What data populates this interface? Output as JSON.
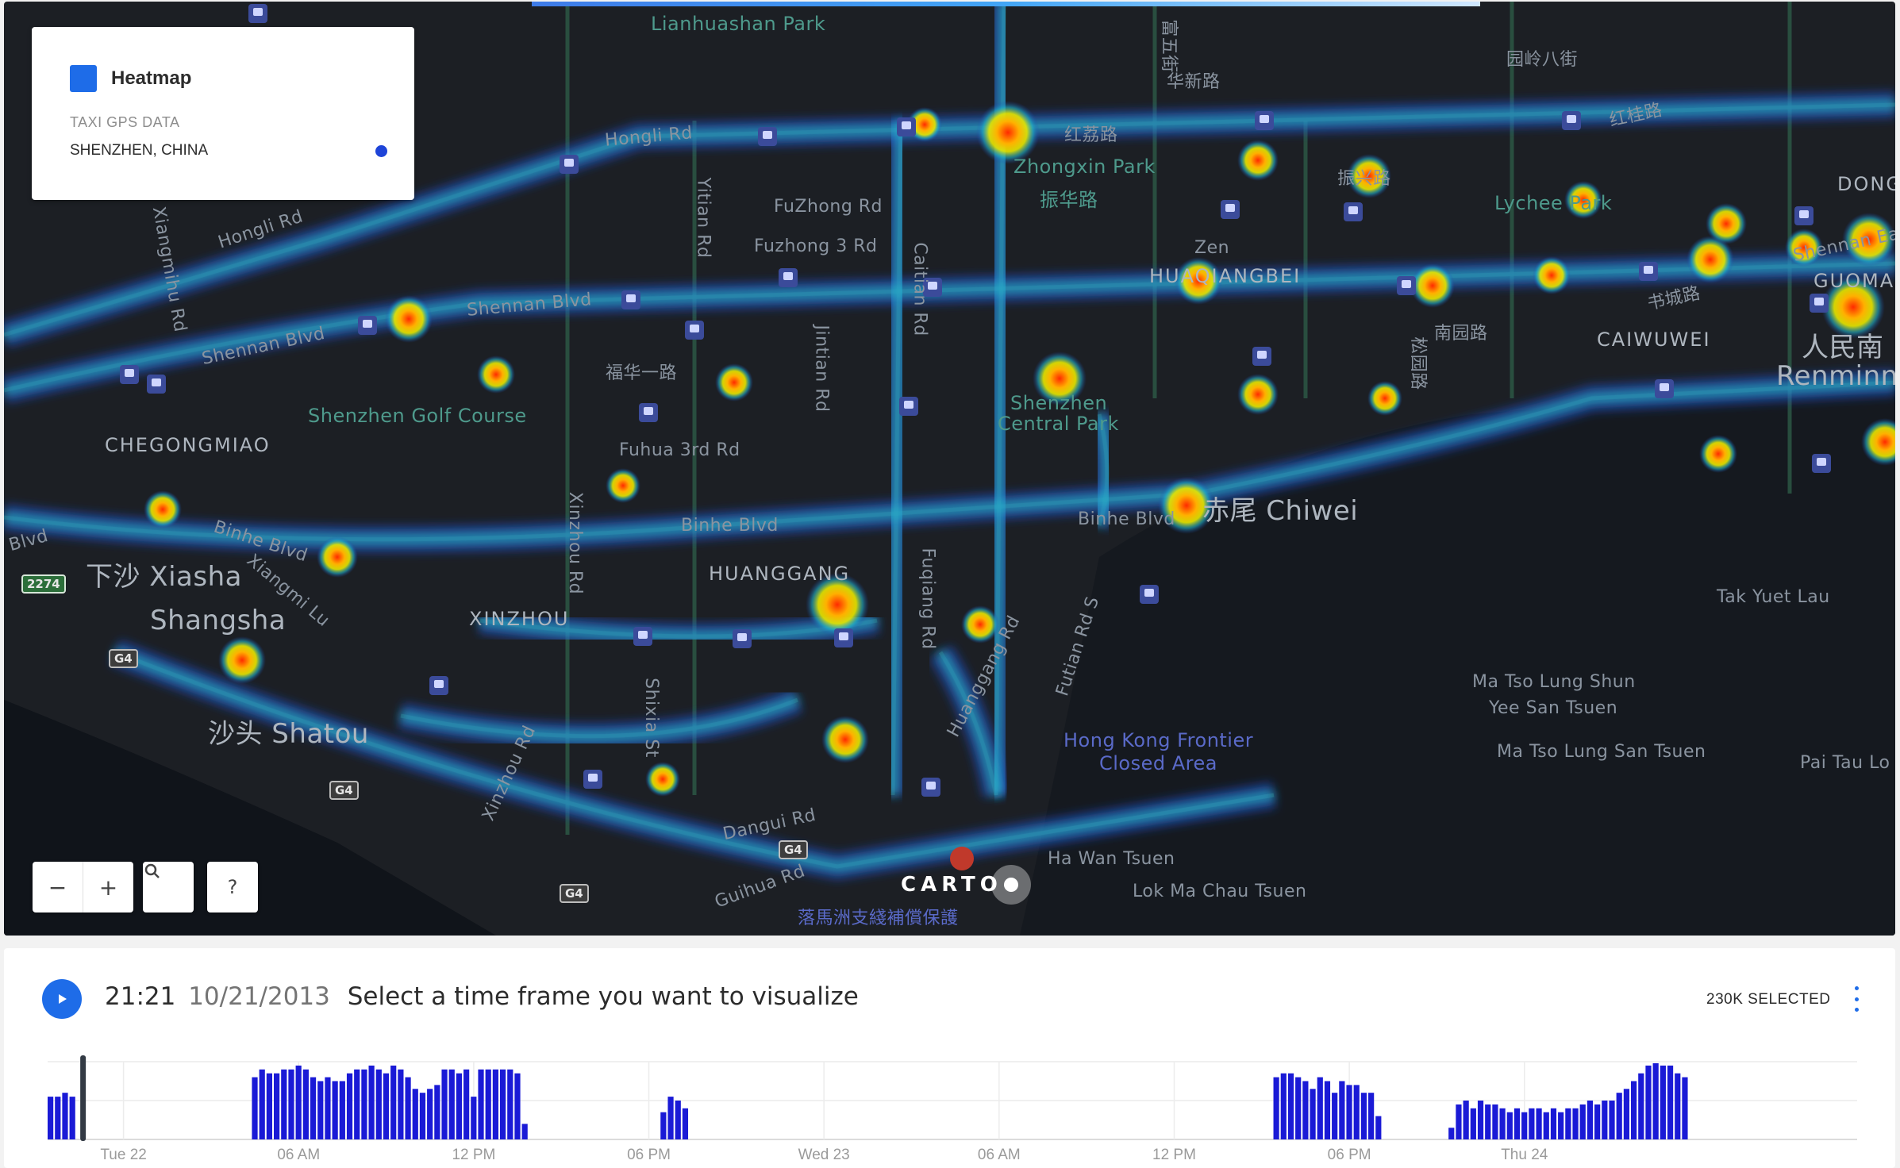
{
  "map": {
    "labels": {
      "lianhuashan_park": "Lianhuashan Park",
      "hongli_rd_top": "Hongli Rd",
      "hongli_rd_left": "Hongli Rd",
      "fuzhong_rd": "FuZhong Rd",
      "fuzhong_3_rd": "Fuzhong 3 Rd",
      "yitian_rd": "Yitian Rd",
      "caitian_rd": "Caitian Rd",
      "zhongxin_park": "Zhongxin Park",
      "zhenhua_lu": "振华路",
      "honglilu_cn": "红荔路",
      "huaqiangbei": "HUAQIANGBEI",
      "zen": "Zen",
      "lychee_park": "Lychee Park",
      "caiwuwei": "CAIWUWEI",
      "renminnan_cn": "人民南",
      "renminna": "Renminna",
      "guomao": "GUOMAO",
      "dong": "DONG",
      "shennan_east": "Shennan East",
      "shennan_blvd_1": "Shennan Blvd",
      "shennan_blvd_2": "Shennan Blvd",
      "xiangmihu_rd": "Xiangmihu Rd",
      "chegongmiao": "CHEGONGMIAO",
      "golf_course": "Shenzhen Golf Course",
      "fuhua_3rd_rd": "Fuhua 3rd Rd",
      "fuhua_yilu_cn": "福华一路",
      "jintian_rd": "Jintian Rd",
      "central_park_1": "Shenzhen",
      "central_park_2": "Central Park",
      "chiwei": "赤尾 Chiwei",
      "binhe_blvd_1": "Binhe Blvd",
      "binhe_blvd_2": "Binhe Blvd",
      "binhe_blvd_3": "Binhe Blvd",
      "binhe_blvd_4": "Blvd",
      "xiasha": "下沙 Xiasha",
      "shangsha": "Shangsha",
      "xiangmi_lu": "Xiangmi Lu",
      "xinzhou": "XINZHOU",
      "huanggang": "HUANGGANG",
      "xinzhou_rd": "Xinzhou Rd",
      "xinzhou_rd_2": "Xinzhou Rd",
      "fuqiang_rd": "Fuqiang Rd",
      "huanggang_rd": "Huanggang Rd",
      "futian_rd_s": "Futian Rd S",
      "shixia_st": "Shixia St",
      "shatou": "沙头 Shatou",
      "tak_yuet_lau": "Tak Yuet Lau",
      "ma_tso_1": "Ma Tso Lung Shun",
      "ma_tso_2": "Yee San Tsuen",
      "ma_tso_3": "Ma Tso Lung San Tsuen",
      "pai_tau_lo": "Pai Tau Lo",
      "frontier_1": "Hong Kong Frontier",
      "frontier_2": "Closed Area",
      "dangui_rd": "Dangui Rd",
      "guihua_rd": "Guihua Rd",
      "ha_wan_tsuen": "Ha Wan Tsuen",
      "lok_ma_chau": "Lok Ma Chau Tsuen",
      "lmc_cn": "落馬洲支綫補償保護",
      "caitian_cn": "华新路",
      "hongwei_cn": "园岭八街",
      "songyuan_cn": "松园路",
      "shucheng_cn": "书城路",
      "nanyuan_cn": "南园路",
      "zhenxing_cn": "振兴路",
      "fushan_cn": "富五街",
      "hongling_cn": "红桂路"
    },
    "shields": {
      "s2274": "2274",
      "g4_a": "G4",
      "g4_b": "G4",
      "g4_c": "G4",
      "g4_d": "G4"
    },
    "carto_logo": "CARTO"
  },
  "legend": {
    "layer_name": "Heatmap",
    "layer_checked": true,
    "category": "TAXI GPS DATA",
    "location": "SHENZHEN, CHINA",
    "dot_color": "#1e44d8"
  },
  "controls": {
    "zoom_out": "−",
    "zoom_in": "+",
    "search_icon": "search-icon",
    "help": "?"
  },
  "timeline": {
    "time": "21:21",
    "date": "10/21/2013",
    "hint": "Select a time frame you want to visualize",
    "selected": "230K SELECTED",
    "accent": "#1e6ce8",
    "bar_color": "#1a1ad6"
  },
  "chart_data": {
    "type": "bar",
    "title": "",
    "xlabel": "",
    "ylabel": "",
    "x_tick_labels": [
      "Tue 22",
      "06 AM",
      "12 PM",
      "06 PM",
      "Wed 23",
      "06 AM",
      "12 PM",
      "06 PM",
      "Thu 24"
    ],
    "ylim": [
      0,
      1
    ],
    "grid": true,
    "series": [
      {
        "segments": [
          {
            "start_hour": 0,
            "values": [
              0.55,
              0.55,
              0.6,
              0.55
            ]
          },
          {
            "start_hour": 7,
            "values": [
              0.8,
              0.9,
              0.85,
              0.85,
              0.9,
              0.9,
              0.95,
              0.9,
              0.8,
              0.75,
              0.8,
              0.75,
              0.75,
              0.85,
              0.9,
              0.9,
              0.95,
              0.9,
              0.85,
              0.95,
              0.9,
              0.8,
              0.65,
              0.6,
              0.65,
              0.7,
              0.9,
              0.9,
              0.85,
              0.9,
              0.55,
              0.9,
              0.9,
              0.9,
              0.9,
              0.9,
              0.85,
              0.2
            ]
          },
          {
            "start_hour": 21,
            "values": [
              0.35,
              0.55,
              0.5,
              0.4
            ]
          },
          {
            "start_hour": 42,
            "values": [
              0.8,
              0.85,
              0.85,
              0.8,
              0.75,
              0.65,
              0.8,
              0.75,
              0.6,
              0.75,
              0.7,
              0.7,
              0.6,
              0.6,
              0.3
            ]
          },
          {
            "start_hour": 48,
            "values": [
              0.15,
              0.45,
              0.5,
              0.4,
              0.5,
              0.45,
              0.45,
              0.4,
              0.35,
              0.4,
              0.35,
              0.4,
              0.4,
              0.35,
              0.4,
              0.35,
              0.4,
              0.4,
              0.45,
              0.5,
              0.45,
              0.5,
              0.5,
              0.6,
              0.65,
              0.75,
              0.85,
              0.95,
              0.98,
              0.95,
              0.95,
              0.85,
              0.8
            ]
          }
        ]
      }
    ],
    "cursor_hour": 1.2
  }
}
